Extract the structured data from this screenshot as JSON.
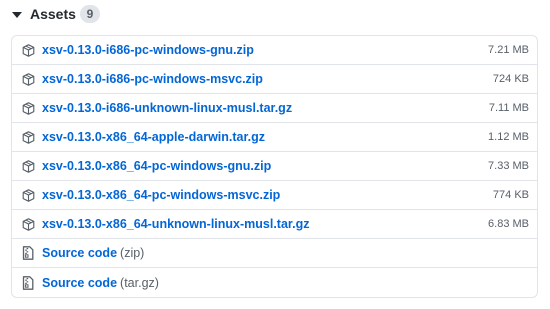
{
  "assets": {
    "title": "Assets",
    "count": "9",
    "files": [
      {
        "name": "xsv-0.13.0-i686-pc-windows-gnu.zip",
        "size": "7.21 MB",
        "icon": "package-icon"
      },
      {
        "name": "xsv-0.13.0-i686-pc-windows-msvc.zip",
        "size": "724 KB",
        "icon": "package-icon"
      },
      {
        "name": "xsv-0.13.0-i686-unknown-linux-musl.tar.gz",
        "size": "7.11 MB",
        "icon": "package-icon"
      },
      {
        "name": "xsv-0.13.0-x86_64-apple-darwin.tar.gz",
        "size": "1.12 MB",
        "icon": "package-icon"
      },
      {
        "name": "xsv-0.13.0-x86_64-pc-windows-gnu.zip",
        "size": "7.33 MB",
        "icon": "package-icon"
      },
      {
        "name": "xsv-0.13.0-x86_64-pc-windows-msvc.zip",
        "size": "774 KB",
        "icon": "package-icon"
      },
      {
        "name": "xsv-0.13.0-x86_64-unknown-linux-musl.tar.gz",
        "size": "6.83 MB",
        "icon": "package-icon"
      }
    ],
    "source": [
      {
        "label": "Source code",
        "suffix": "(zip)",
        "icon": "file-zip-icon"
      },
      {
        "label": "Source code",
        "suffix": "(tar.gz)",
        "icon": "file-zip-icon"
      }
    ]
  },
  "colors": {
    "link": "#0366d6",
    "muted": "#586069",
    "border": "#e1e4e8"
  }
}
